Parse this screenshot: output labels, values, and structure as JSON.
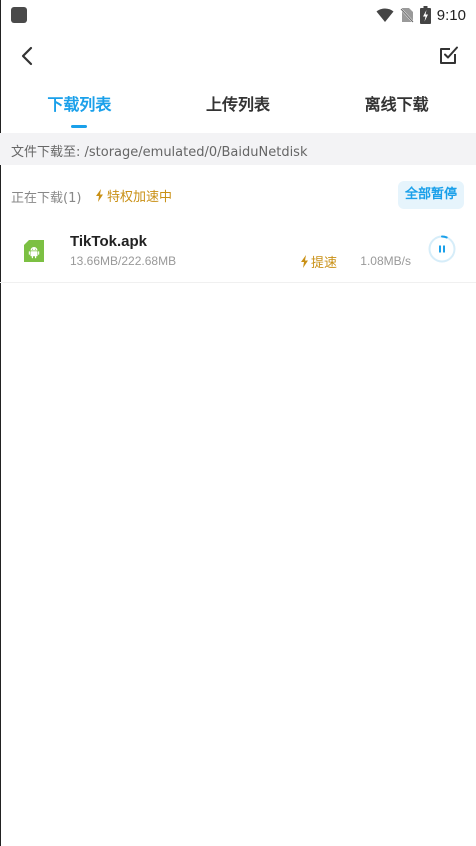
{
  "status_bar": {
    "time": "9:10",
    "icons": [
      "app-notification-icon",
      "wifi-icon",
      "no-sim-icon",
      "battery-charging-icon"
    ]
  },
  "header": {
    "back_icon": "chevron-left-icon",
    "select_icon": "checkbox-edit-icon"
  },
  "tabs": [
    {
      "label": "下载列表",
      "active": true
    },
    {
      "label": "上传列表",
      "active": false
    },
    {
      "label": "离线下载",
      "active": false
    }
  ],
  "path": {
    "text": "文件下载至: /storage/emulated/0/BaiduNetdisk"
  },
  "downloading": {
    "count_label": "正在下载(1)",
    "accel_label": "特权加速中",
    "pause_all_label": "全部暂停"
  },
  "files": [
    {
      "name": "TikTok.apk",
      "size": "13.66MB/222.68MB",
      "boost_label": "提速",
      "speed": "1.08MB/s",
      "icon": "android-apk-icon",
      "progress": 0.0613
    }
  ],
  "colors": {
    "accent": "#1aa0ea",
    "gold": "#c99015",
    "apk_green": "#7cc043"
  }
}
